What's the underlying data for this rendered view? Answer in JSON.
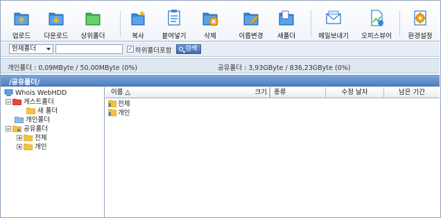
{
  "toolbar": {
    "upload": "업로드",
    "download": "다운로드",
    "parent_folder": "상위폴더",
    "copy": "복사",
    "paste": "붙여넣기",
    "delete": "삭제",
    "rename": "이름변경",
    "new_folder": "새폴더",
    "send_mail": "메일보내기",
    "office_viewer": "오피스뷰어",
    "settings": "환경설정"
  },
  "search": {
    "scope_selected": "현재폴더",
    "input_value": "",
    "include_subfolders_label": "하위폴더포함",
    "include_subfolders_checked": true,
    "search_button": "검색"
  },
  "capacity": {
    "personal": "개인폴더 : 0,09MByte / 50,00MByte (0%)",
    "shared": "공유폴더 : 3,93GByte / 836,23GByte (0%)"
  },
  "path": "/공유폴더/",
  "tree": {
    "root": "Whois WebHDD",
    "guest": "게스트폴더",
    "guest_new": "새 폴더",
    "personal": "개인폴더",
    "shared": "공유폴더",
    "shared_all": "전체",
    "shared_personal": "개인"
  },
  "list": {
    "columns": [
      "이름 △",
      "크기",
      "종류",
      "수정 날자",
      "남은 기간"
    ],
    "rows": [
      "전체",
      "개인"
    ]
  },
  "colors": {
    "accent": "#4f80c2",
    "folder_yellow": "#f5c33b",
    "folder_red": "#e0453b"
  }
}
